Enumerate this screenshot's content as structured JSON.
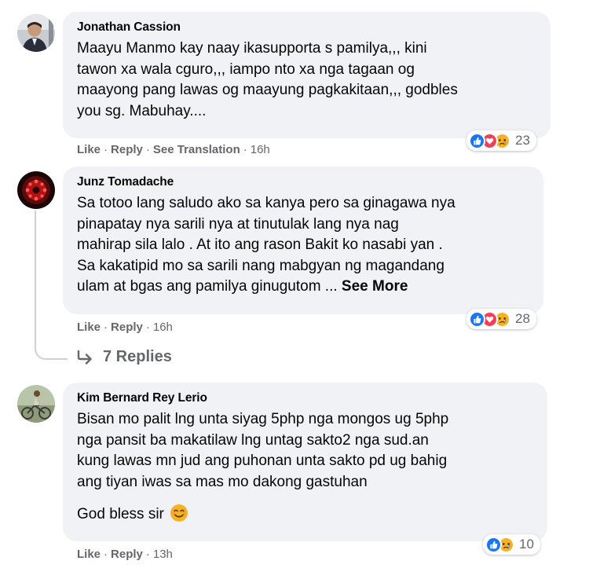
{
  "comments": [
    {
      "author": "Jonathan Cassion",
      "lines": [
        "Maayu Manmo kay naay ikasupporta s pamilya,,, kini",
        "tawon xa wala cguro,,, iampo nto xa nga tagaan og",
        "maayong pang lawas og maayung pagkakitaan,,, godbles",
        "you sg. Mabuhay...."
      ],
      "reactions": [
        "like",
        "love",
        "sad"
      ],
      "reaction_count": "23",
      "actions": {
        "like": "Like",
        "reply": "Reply",
        "translation": "See Translation",
        "time": "16h"
      }
    },
    {
      "author": "Junz Tomadache",
      "lines": [
        "Sa totoo lang saludo ako sa kanya pero sa ginagawa nya",
        "pinapatay nya sarili nya at tinutulak lang nya nag",
        "mahirap sila lalo . At ito ang rason Bakit ko nasabi yan .",
        "Sa kakatipid mo sa sarili nang mabgyan ng magandang"
      ],
      "last_line": "ulam at bgas ang pamilya ginugutom ...",
      "see_more": "See More",
      "reactions": [
        "like",
        "love",
        "sad"
      ],
      "reaction_count": "28",
      "actions": {
        "like": "Like",
        "reply": "Reply",
        "time": "16h"
      },
      "replies_label": "7 Replies"
    },
    {
      "author": "Kim Bernard Rey Lerio",
      "lines": [
        "Bisan mo palit lng unta siyag 5php nga mongos ug 5php",
        "nga pansit ba makatilaw lng untag sakto2 nga sud.an",
        "kung lawas mn jud ang puhonan unta sakto pd ug bahig",
        "ang tiyan iwas sa mas mo dakong gastuhan"
      ],
      "closing_line": "God bless sir",
      "reactions": [
        "like",
        "sad"
      ],
      "reaction_count": "10",
      "actions": {
        "like": "Like",
        "reply": "Reply",
        "time": "13h"
      }
    }
  ],
  "separator": "·",
  "colors": {
    "bubble": "#f0f2f5",
    "meta": "#65676b",
    "like": "#1877f2",
    "love": "#f33e58",
    "sad": "#f7b125"
  }
}
